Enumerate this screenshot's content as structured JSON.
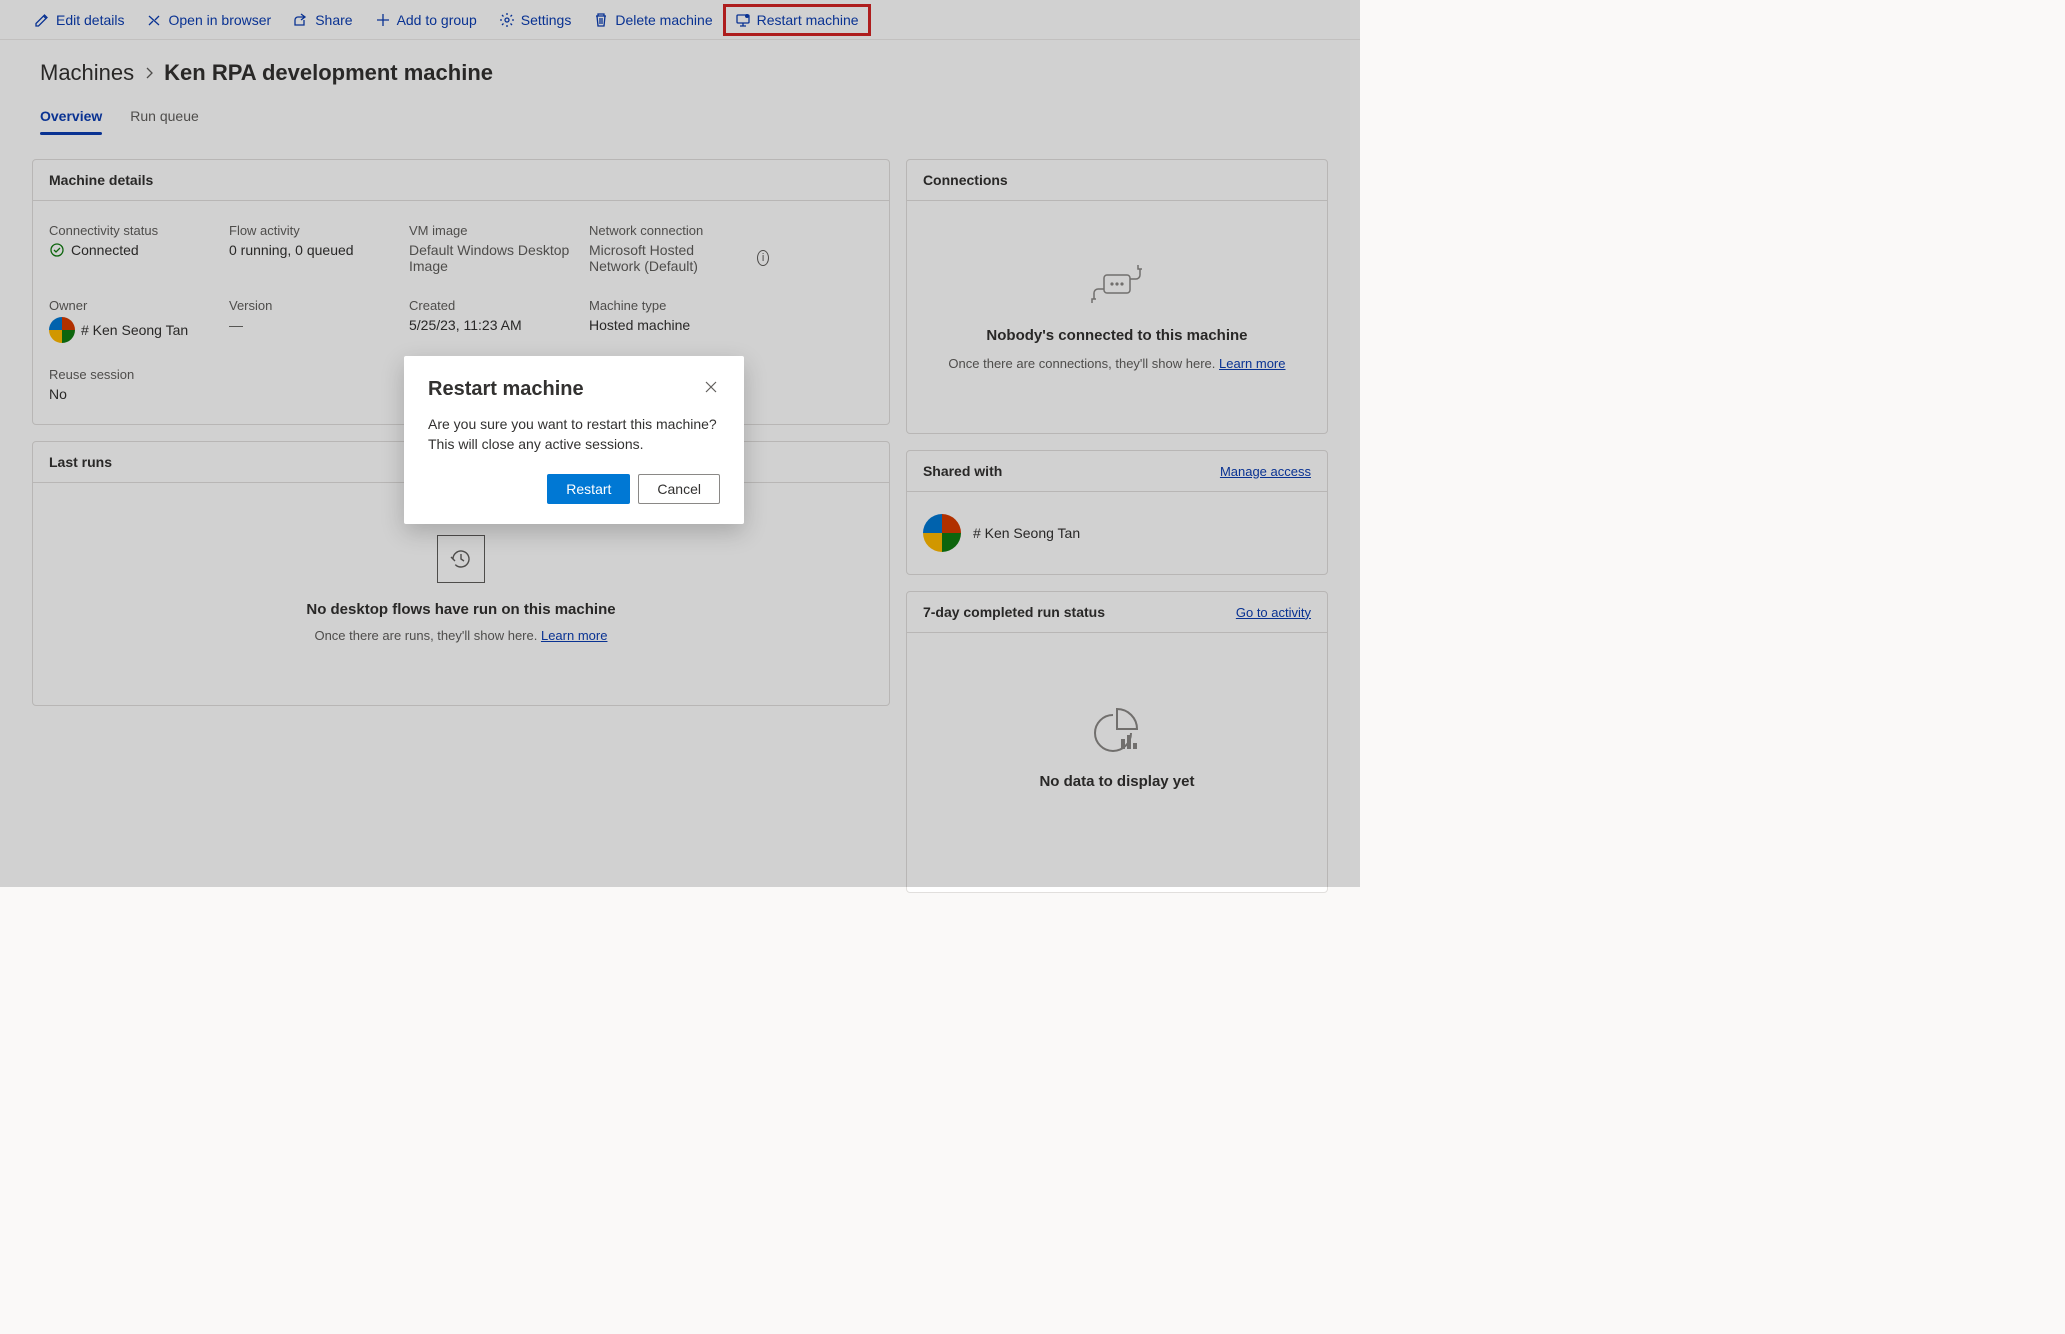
{
  "commandBar": {
    "editDetails": "Edit details",
    "openInBrowser": "Open in browser",
    "share": "Share",
    "addToGroup": "Add to group",
    "settings": "Settings",
    "deleteMachine": "Delete machine",
    "restartMachine": "Restart machine"
  },
  "breadcrumb": {
    "root": "Machines",
    "current": "Ken RPA development machine"
  },
  "tabs": {
    "overview": "Overview",
    "runQueue": "Run queue"
  },
  "machineDetails": {
    "title": "Machine details",
    "connectivityStatus": {
      "label": "Connectivity status",
      "value": "Connected"
    },
    "flowActivity": {
      "label": "Flow activity",
      "value": "0 running, 0 queued"
    },
    "vmImage": {
      "label": "VM image",
      "value": "Default Windows Desktop Image"
    },
    "networkConnection": {
      "label": "Network connection",
      "value": "Microsoft Hosted Network (Default)"
    },
    "owner": {
      "label": "Owner",
      "value": "# Ken Seong Tan"
    },
    "version": {
      "label": "Version",
      "value": "—"
    },
    "created": {
      "label": "Created",
      "value": "5/25/23, 11:23 AM"
    },
    "machineType": {
      "label": "Machine type",
      "value": "Hosted machine"
    },
    "reuseSession": {
      "label": "Reuse session",
      "value": "No"
    }
  },
  "lastRuns": {
    "title": "Last runs",
    "emptyHeadline": "No desktop flows have run on this machine",
    "emptySub": "Once there are runs, they'll show here.",
    "learnMore": "Learn more"
  },
  "connections": {
    "title": "Connections",
    "emptyHeadline": "Nobody's connected to this machine",
    "emptySub": "Once there are connections, they'll show here.",
    "learnMore": "Learn more"
  },
  "sharedWith": {
    "title": "Shared with",
    "manageAccess": "Manage access",
    "user": "# Ken Seong Tan"
  },
  "runStatus": {
    "title": "7-day completed run status",
    "goToActivity": "Go to activity",
    "emptyHeadline": "No data to display yet"
  },
  "dialog": {
    "title": "Restart machine",
    "body": "Are you sure you want to restart this machine? This will close any active sessions.",
    "primary": "Restart",
    "secondary": "Cancel"
  },
  "colors": {
    "primary": "#0078d4",
    "link": "#0b3db3",
    "highlight": "#d52424"
  }
}
